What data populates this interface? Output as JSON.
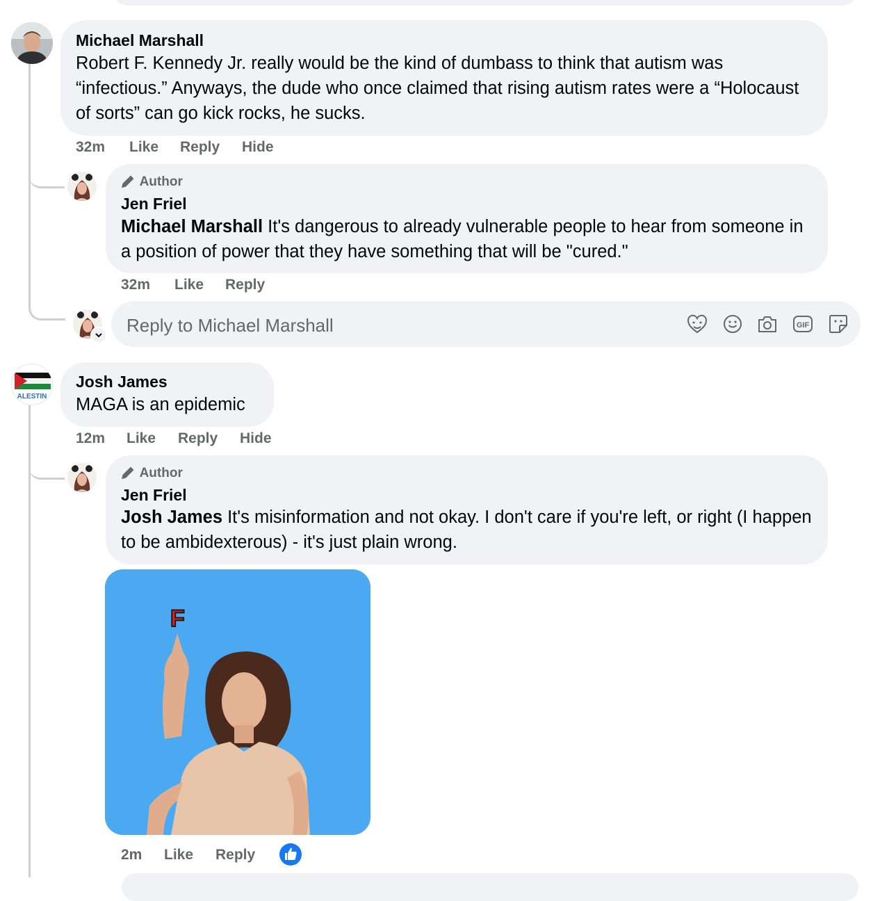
{
  "comments": [
    {
      "author": "Michael Marshall",
      "text": "Robert F. Kennedy Jr. really would be the kind of dumbass to think that autism was “infectious.” Anyways, the dude who once claimed that rising autism rates were a “Holocaust of sorts” can go kick rocks, he sucks.",
      "time": "32m",
      "like": "Like",
      "reply": "Reply",
      "hide": "Hide",
      "replies": [
        {
          "badge": "Author",
          "author": "Jen Friel",
          "mention": "Michael Marshall",
          "text": " It's dangerous to already vulnerable people to hear from someone in a position of power that they have something that will be \"cured.\"",
          "time": "32m",
          "like": "Like",
          "reply": "Reply"
        }
      ],
      "reply_box": {
        "placeholder": "Reply to Michael Marshall"
      }
    },
    {
      "author": "Josh James",
      "text": "MAGA is an epidemic",
      "time": "12m",
      "like": "Like",
      "reply": "Reply",
      "hide": "Hide",
      "avatar_text": "ALESTIN",
      "replies": [
        {
          "badge": "Author",
          "author": "Jen Friel",
          "mention": "Josh James",
          "text": " It's misinformation and not okay. I don't care if you're left, or right (I happen to be ambidexterous) - it's just plain wrong.",
          "time": "2m",
          "like": "Like",
          "reply": "Reply",
          "gif": {
            "letter": "F",
            "background": "#4aa8f0"
          }
        }
      ]
    }
  ],
  "composer_icons": [
    "avatar-sticker-icon",
    "emoji-icon",
    "camera-icon",
    "gif-icon",
    "sticker-icon"
  ],
  "colors": {
    "bubble": "#f0f2f5",
    "meta": "#65676b",
    "like_blue": "#1877f2"
  }
}
